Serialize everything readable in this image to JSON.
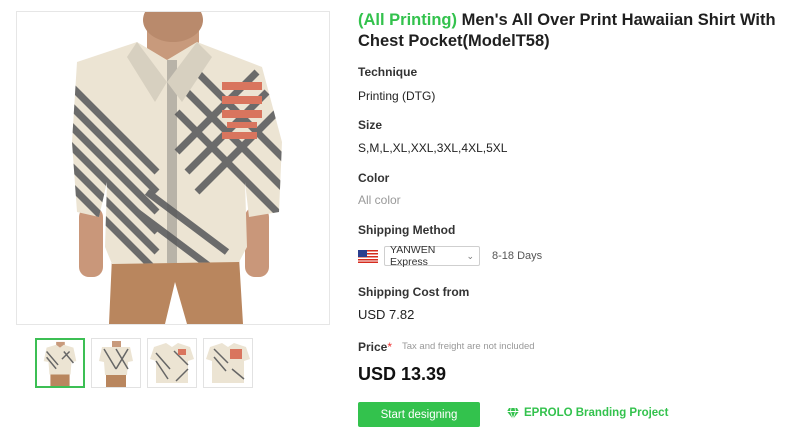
{
  "product": {
    "tag": "(All Printing)",
    "title": " Men's All Over Print Hawaiian Shirt With Chest Pocket(ModelT58)"
  },
  "technique": {
    "label": "Technique",
    "value": "Printing (DTG)"
  },
  "size": {
    "label": "Size",
    "value": "S,M,L,XL,XXL,3XL,4XL,5XL"
  },
  "color": {
    "label": "Color",
    "value": "All color"
  },
  "shipping_method": {
    "label": "Shipping Method",
    "flag_icon": "us-flag-icon",
    "carrier": "YANWEN Express",
    "days": "8-18 Days"
  },
  "shipping_cost": {
    "label": "Shipping Cost from",
    "value": "USD 7.82"
  },
  "price": {
    "label": "Price",
    "required_mark": "*",
    "note": "Tax and freight are not included",
    "value": "USD 13.39"
  },
  "actions": {
    "start_designing": "Start designing",
    "branding_project": "EPROLO Branding Project"
  },
  "colors": {
    "accent": "#33c24d",
    "required": "#ee3333"
  },
  "gallery": {
    "thumbnail_count": 4,
    "active_index": 0
  }
}
